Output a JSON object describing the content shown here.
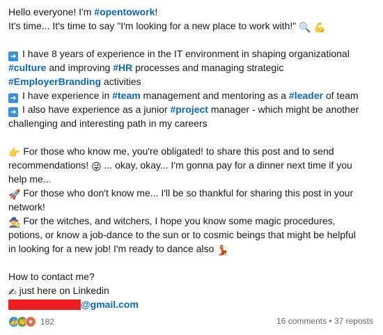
{
  "post": {
    "l1a": "Hello everyone! I'm ",
    "l1tag": "#opentowork",
    "l1b": "!",
    "l2": "It's time... It's time to say \"I'm looking for a new place to work with!\"",
    "l3": "I have 8 years of experience in the IT environment in shaping organizational",
    "l4tag1": "#culture",
    "l4a": " and improving ",
    "l4tag2": "#HR",
    "l4b": " processes and managing strategic",
    "l5tag": "#EmployerBranding",
    "l5a": " activities",
    "l6a": "I have experience in ",
    "l6tag1": "#team",
    "l6b": " management and mentoring as a ",
    "l6tag2": "#leader",
    "l6c": " of team",
    "l7a": "I also have experience as a junior ",
    "l7tag": "#project",
    "l7b": " manager - which might be another",
    "l8": "challenging and interesting path in my careers",
    "l9": "For those who know me, you're obligated! to share this post and to send",
    "l10a": "recommendations! ",
    "l10b": " ... okay, okay... I'm gonna pay for a dinner next time if you",
    "l11": "help me...",
    "l12": "For those who don't know me... I'll be so thankful for sharing this post in your",
    "l13": "network!",
    "l14": "For the witches, and witchers, I hope you know some magic procedures,",
    "l15": "potions, or know a job-dance to the sun or to cosmic beings that might be helpful",
    "l16a": "in looking for a new job! I'm ready to dance also ",
    "l17": "How to contact me?",
    "l18": "just here on Linkedin",
    "email_suffix": "@gmail.com"
  },
  "footer": {
    "reaction_count": "182",
    "comments": "16 comments",
    "separator": " • ",
    "reposts": "37 reposts"
  },
  "icons": {
    "arrow": "right-arrow-icon",
    "magnifier": "magnifier-icon",
    "flex": "flexed-biceps-icon",
    "point": "pointing-hand-icon",
    "wink": "winking-face-icon",
    "rocket": "rocket-icon",
    "mage": "mage-icon",
    "dancer": "dancer-icon",
    "write": "writing-hand-icon"
  },
  "colors": {
    "hashtag": "#0a66c2",
    "redaction": "#ef1d1d"
  }
}
